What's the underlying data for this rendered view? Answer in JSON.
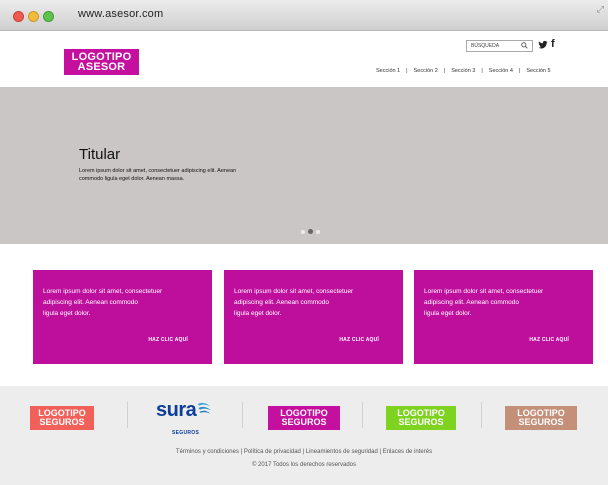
{
  "browser": {
    "url": "www.asesor.com"
  },
  "header": {
    "logo_line1": "LOGOTIPO",
    "logo_line2": "ASESOR",
    "search_placeholder": "BÚSQUEDA",
    "nav": [
      "Sección 1",
      "Sección 2",
      "Sección 3",
      "Sección 4",
      "Sección 5"
    ],
    "nav_separator": "|"
  },
  "hero": {
    "title": "Titular",
    "text": "Lorem ipsum dolor sit amet, consectetuer adipiscing elit. Aenean commodo ligula eget dolor. Aenean massa.",
    "slides": 3,
    "active_slide": 2
  },
  "cards": [
    {
      "line1": "Lorem ipsum dolor sit amet, consectetuer",
      "line2": "adipiscing elit. Aenean commodo",
      "line3": "ligula eget dolor.",
      "link": "HAZ CLIC AQUÍ"
    },
    {
      "line1": "Lorem ipsum dolor sit amet, consectetuer",
      "line2": "adipiscing elit. Aenean commodo",
      "line3": "ligula eget dolor.",
      "link": "HAZ CLIC AQUÍ"
    },
    {
      "line1": "Lorem ipsum dolor sit amet, consectetuer",
      "line2": "adipiscing elit. Aenean commodo",
      "line3": "ligula eget dolor.",
      "link": "HAZ CLIC AQUÍ"
    }
  ],
  "footer": {
    "logos": [
      {
        "line1": "LOGOTIPO",
        "line2": "SEGUROS",
        "color": "#f2605a"
      },
      {
        "line1": "LOGOTIPO",
        "line2": "SEGUROS",
        "color": "#c40f9f"
      },
      {
        "line1": "LOGOTIPO",
        "line2": "SEGUROS",
        "color": "#7ed321"
      },
      {
        "line1": "LOGOTIPO",
        "line2": "SEGUROS",
        "color": "#c4907a"
      }
    ],
    "sura_name": "sura",
    "sura_sub": "SEGUROS",
    "links": "Términos y condiciones | Política de privacidad | Lineamientos de seguridad | Enlaces de interés",
    "copyright": "© 2017 Todos los derechos reservados"
  },
  "colors": {
    "accent": "#be0f9c",
    "hero_bg": "#c9c6c5",
    "footer_bg": "#ededed"
  }
}
